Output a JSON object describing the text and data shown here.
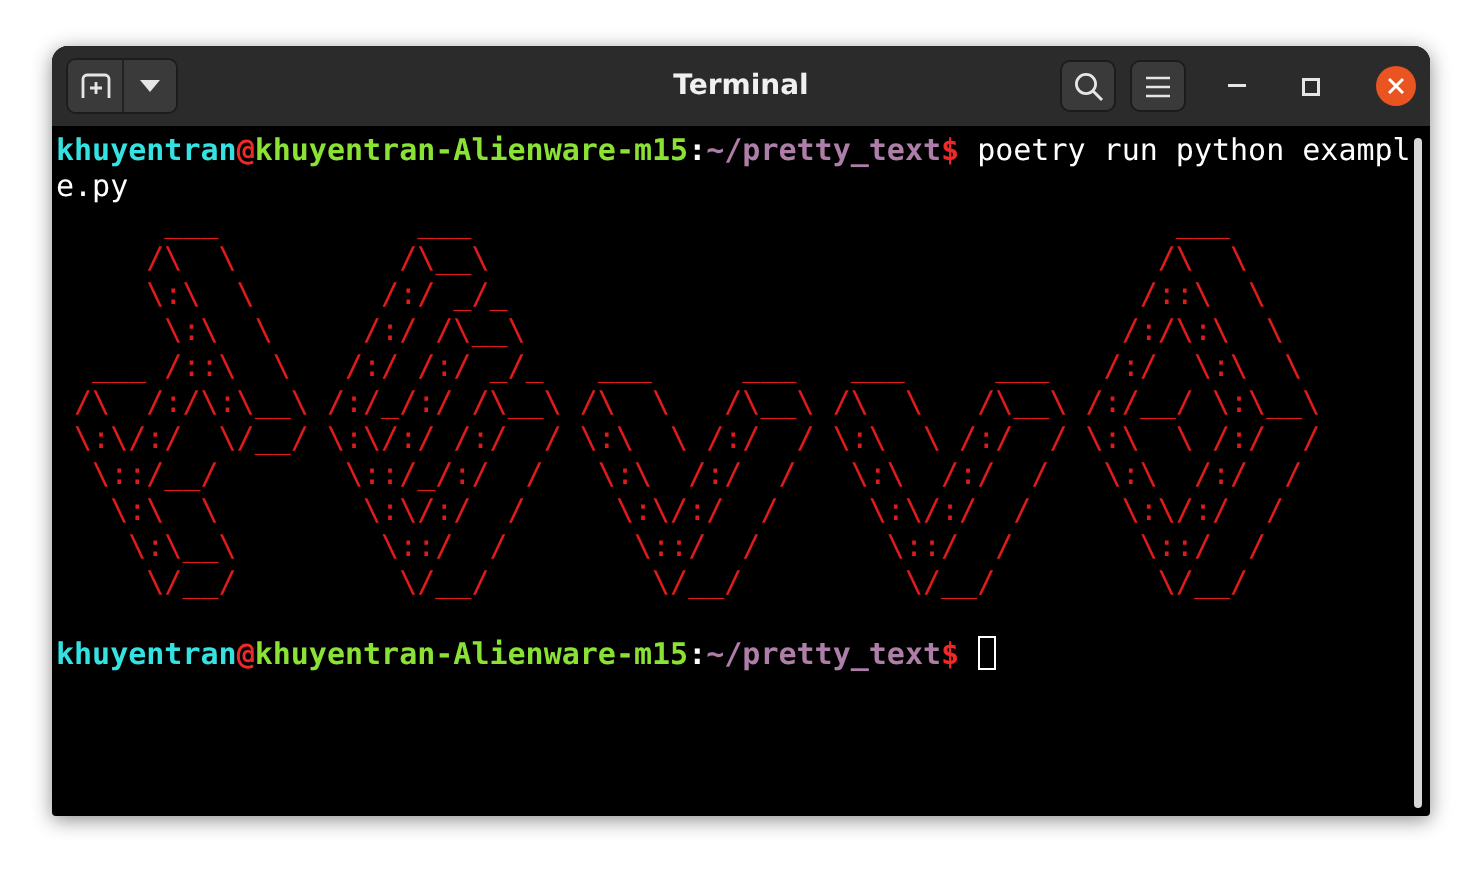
{
  "window": {
    "title": "Terminal"
  },
  "terminal": {
    "lines": [
      {
        "kind": "prompt",
        "user": "khuyentran",
        "at": "@",
        "host": "khuyentran-Alienware-m15",
        "colon": ":",
        "path": "~/pretty_text",
        "dollar": "$",
        "command": "poetry run python exampl",
        "cursor": false
      },
      {
        "kind": "output",
        "text": "e.py"
      },
      {
        "kind": "art",
        "lines": [
          "      ___           ___                                       ___",
          "     /\\  \\         /\\__\\                                     /\\  \\",
          "     \\:\\  \\       /:/ _/_                                   /::\\  \\",
          "      \\:\\  \\     /:/ /\\__\\                                 /:/\\:\\  \\",
          "  ___ /::\\  \\   /:/ /:/ _/_   ___     ___   ___     ___   /:/  \\:\\  \\",
          " /\\  /:/\\:\\__\\ /:/_/:/ /\\__\\ /\\  \\   /\\__\\ /\\  \\   /\\__\\ /:/__/ \\:\\__\\",
          " \\:\\/:/  \\/__/ \\:\\/:/ /:/  / \\:\\  \\ /:/  / \\:\\  \\ /:/  / \\:\\  \\ /:/  /",
          "  \\::/__/       \\::/_/:/  /   \\:\\  /:/  /   \\:\\  /:/  /   \\:\\  /:/  /",
          "   \\:\\  \\        \\:\\/:/  /     \\:\\/:/  /     \\:\\/:/  /     \\:\\/:/  /",
          "    \\:\\__\\        \\::/  /       \\::/  /       \\::/  /       \\::/  /",
          "     \\/__/         \\/__/         \\/__/         \\/__/         \\/__/"
        ]
      },
      {
        "kind": "blank"
      },
      {
        "kind": "prompt",
        "user": "khuyentran",
        "at": "@",
        "host": "khuyentran-Alienware-m15",
        "colon": ":",
        "path": "~/pretty_text",
        "dollar": "$",
        "cursor": true
      }
    ]
  }
}
